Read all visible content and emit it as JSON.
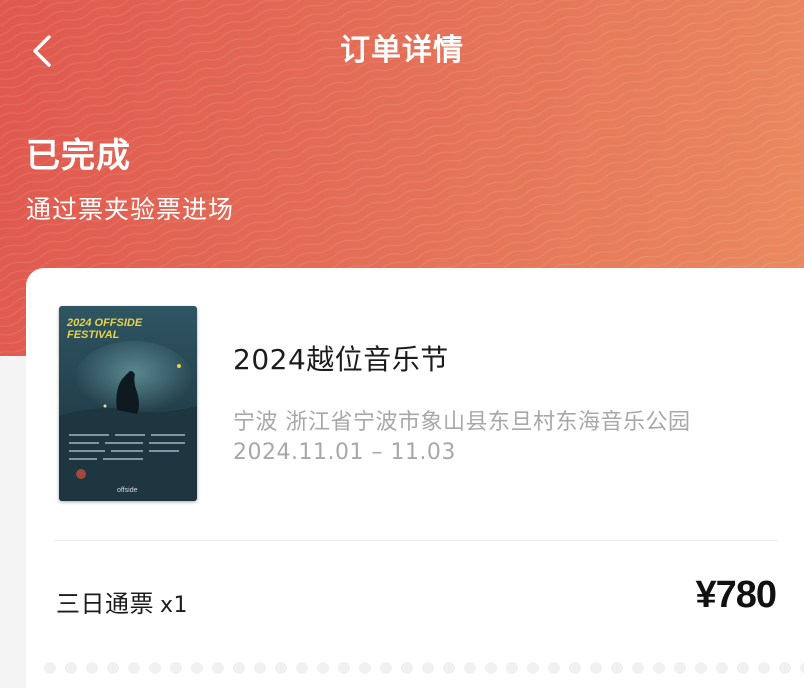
{
  "nav": {
    "title": "订单详情",
    "back_icon": "chevron-left-icon"
  },
  "status": {
    "title": "已完成",
    "subtitle": "通过票夹验票进场"
  },
  "event": {
    "poster_heading_line1": "2024 OFFSIDE",
    "poster_heading_line2": "FESTIVAL",
    "poster_brand": "offside",
    "title": "2024越位音乐节",
    "venue": "宁波 浙江省宁波市象山县东旦村东海音乐公园",
    "date": "2024.11.01 – 11.03"
  },
  "ticket": {
    "type": "三日通票",
    "quantity": "x1",
    "price": "¥780"
  },
  "colors": {
    "header_start": "#e0584f",
    "header_end": "#ea8a5f",
    "poster_accent": "#e6d24a"
  }
}
